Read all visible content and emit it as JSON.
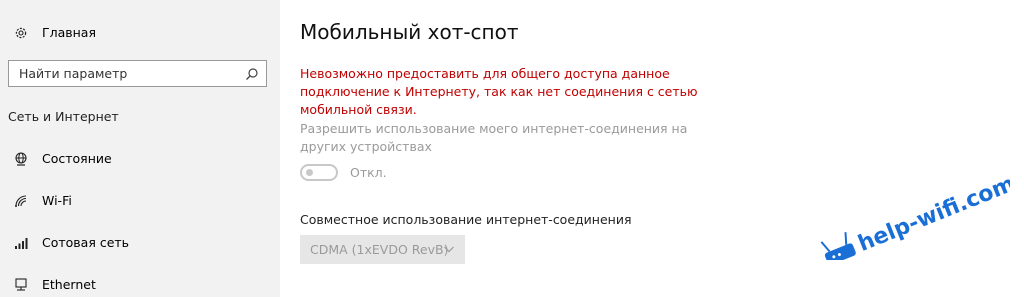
{
  "sidebar": {
    "home_label": "Главная",
    "search_placeholder": "Найти параметр",
    "section_title": "Сеть и Интернет",
    "items": [
      {
        "label": "Состояние",
        "icon": "globe-monitor-icon"
      },
      {
        "label": "Wi-Fi",
        "icon": "wifi-icon"
      },
      {
        "label": "Сотовая сеть",
        "icon": "cellular-signal-icon"
      },
      {
        "label": "Ethernet",
        "icon": "ethernet-icon"
      }
    ]
  },
  "main": {
    "title": "Мобильный хот-спот",
    "error_lines": [
      "Невозможно предоставить для общего доступа данное",
      "подключение к Интернету, так как нет соединения с сетью",
      "мобильной связи."
    ],
    "share_description_lines": [
      "Разрешить использование моего интернет-соединения на",
      "других устройствах"
    ],
    "toggle_state_label": "Откл.",
    "toggle_on": false,
    "connection_share_title": "Совместное использование интернет-соединения",
    "connection_select_value": "CDMA (1xEVDO RevB)"
  },
  "watermark": {
    "text": "help-wifi.com"
  },
  "colors": {
    "error_text": "#c00000",
    "disabled_text": "#9a9a9a",
    "sidebar_bg": "#f2f2f2",
    "watermark_blue": "#1a6fd6"
  }
}
